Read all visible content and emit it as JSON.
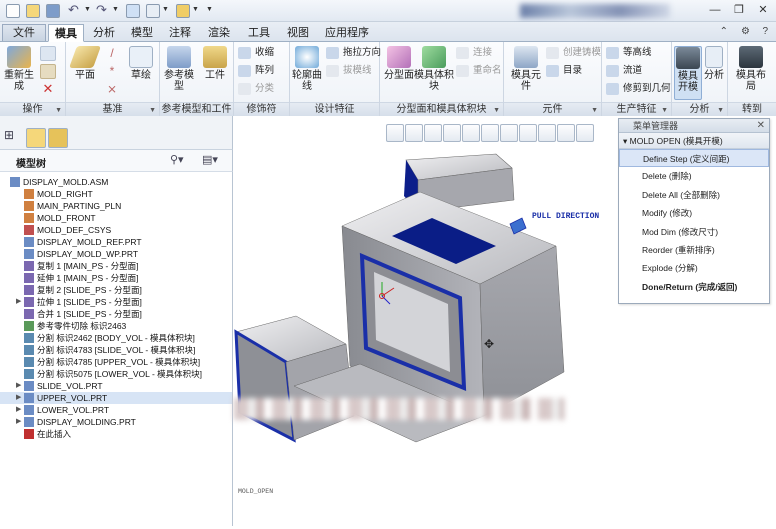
{
  "quick_access": {
    "icons": [
      "new-icon",
      "open-icon",
      "save-icon",
      "undo-icon",
      "redo-icon",
      "regenerate-icon",
      "windows-icon",
      "folder-icon"
    ]
  },
  "window_controls": {
    "help": "?",
    "minimize": "—",
    "restore": "❐",
    "close": "✕"
  },
  "tabs": [
    "文件",
    "模具",
    "分析",
    "模型",
    "注释",
    "渲染",
    "工具",
    "视图",
    "应用程序"
  ],
  "active_tab": "模具",
  "groups": {
    "operations": {
      "label": "操作",
      "regenerate": "重新生成"
    },
    "datum": {
      "label": "基准",
      "plane": "平面",
      "sketch": "草绘"
    },
    "ref_model": {
      "label": "参考模型和工件",
      "ref_model": "参考模型",
      "workpiece": "工件"
    },
    "modifiers": {
      "label": "修饰符",
      "shrink": "收缩",
      "pattern": "阵列",
      "classify": "分类"
    },
    "design_feature": {
      "label": "设计特征",
      "silhouette": "轮廓曲线",
      "draft_dir": "拖拉方向",
      "draft_line": "拔模线"
    },
    "parting": {
      "label": "分型面和模具体积块",
      "parting_surface": "分型面",
      "mold_volume": "模具体积块",
      "connect": "连接",
      "rename": "重命名"
    },
    "component": {
      "label": "元件",
      "mold_comp": "模具元件",
      "create_casting": "创建铸模",
      "catalog": "目录"
    },
    "production": {
      "label": "生产特征",
      "isoline": "等高线",
      "runner": "流道",
      "trim_geometry": "修剪到几何"
    },
    "analysis": {
      "label": "分析",
      "mold_open": "模具开模",
      "analysis": "分析"
    },
    "goto": {
      "label": "转到",
      "mold_layout": "模具布局"
    }
  },
  "tree": {
    "title": "模型树",
    "items": [
      {
        "text": "DISPLAY_MOLD.ASM",
        "indent": 0,
        "arrow": "",
        "color": "#6b8cc4"
      },
      {
        "text": "MOLD_RIGHT",
        "indent": 1,
        "arrow": "",
        "color": "#d08040"
      },
      {
        "text": "MAIN_PARTING_PLN",
        "indent": 1,
        "arrow": "",
        "color": "#d08040"
      },
      {
        "text": "MOLD_FRONT",
        "indent": 1,
        "arrow": "",
        "color": "#d08040"
      },
      {
        "text": "MOLD_DEF_CSYS",
        "indent": 1,
        "arrow": "",
        "color": "#c05050"
      },
      {
        "text": "DISPLAY_MOLD_REF.PRT",
        "indent": 1,
        "arrow": "",
        "color": "#6b8cc4"
      },
      {
        "text": "DISPLAY_MOLD_WP.PRT",
        "indent": 1,
        "arrow": "",
        "color": "#6b8cc4"
      },
      {
        "text": "复制 1 [MAIN_PS - 分型面]",
        "indent": 1,
        "arrow": "",
        "color": "#7b68b0"
      },
      {
        "text": "延伸 1 [MAIN_PS - 分型面]",
        "indent": 1,
        "arrow": "",
        "color": "#7b68b0"
      },
      {
        "text": "复制 2 [SLIDE_PS - 分型面]",
        "indent": 1,
        "arrow": "",
        "color": "#7b68b0"
      },
      {
        "text": "拉伸 1 [SLIDE_PS - 分型面]",
        "indent": 1,
        "arrow": "▶",
        "color": "#7b68b0"
      },
      {
        "text": "合并 1 [SLIDE_PS - 分型面]",
        "indent": 1,
        "arrow": "",
        "color": "#7b68b0"
      },
      {
        "text": "参考零件切除 标识2463",
        "indent": 1,
        "arrow": "",
        "color": "#5a9a5a"
      },
      {
        "text": "分割 标识2462 [BODY_VOL - 模具体积块]",
        "indent": 1,
        "arrow": "",
        "color": "#5a8ab0"
      },
      {
        "text": "分割 标识4783 [SLIDE_VOL - 模具体积块]",
        "indent": 1,
        "arrow": "",
        "color": "#5a8ab0"
      },
      {
        "text": "分割 标识4785 [UPPER_VOL - 模具体积块]",
        "indent": 1,
        "arrow": "",
        "color": "#5a8ab0"
      },
      {
        "text": "分割 标识5075 [LOWER_VOL - 模具体积块]",
        "indent": 1,
        "arrow": "",
        "color": "#5a8ab0"
      },
      {
        "text": "SLIDE_VOL.PRT",
        "indent": 1,
        "arrow": "▶",
        "color": "#6b8cc4"
      },
      {
        "text": "UPPER_VOL.PRT",
        "indent": 1,
        "arrow": "▶",
        "color": "#6b8cc4"
      },
      {
        "text": "LOWER_VOL.PRT",
        "indent": 1,
        "arrow": "▶",
        "color": "#6b8cc4"
      },
      {
        "text": "DISPLAY_MOLDING.PRT",
        "indent": 1,
        "arrow": "▶",
        "color": "#6b8cc4"
      },
      {
        "text": "在此插入",
        "indent": 1,
        "arrow": "",
        "color": "#c03030"
      }
    ]
  },
  "viewport": {
    "pull_direction": "PULL DIRECTION",
    "status": "MOLD_OPEN"
  },
  "menu": {
    "title": "菜单管理器",
    "submenu": "MOLD OPEN (模具开模)",
    "items": [
      {
        "text": "Define Step (定义间距)",
        "selected": true,
        "bold": false
      },
      {
        "text": "Delete (删除)",
        "selected": false,
        "bold": false
      },
      {
        "text": "Delete All (全部删除)",
        "selected": false,
        "bold": false
      },
      {
        "text": "Modify (修改)",
        "selected": false,
        "bold": false
      },
      {
        "text": "Mod Dim (修改尺寸)",
        "selected": false,
        "bold": false
      },
      {
        "text": "Reorder (重新排序)",
        "selected": false,
        "bold": false
      },
      {
        "text": "Explode (分解)",
        "selected": false,
        "bold": false
      },
      {
        "text": "Done/Return (完成/返回)",
        "selected": false,
        "bold": true
      }
    ]
  }
}
